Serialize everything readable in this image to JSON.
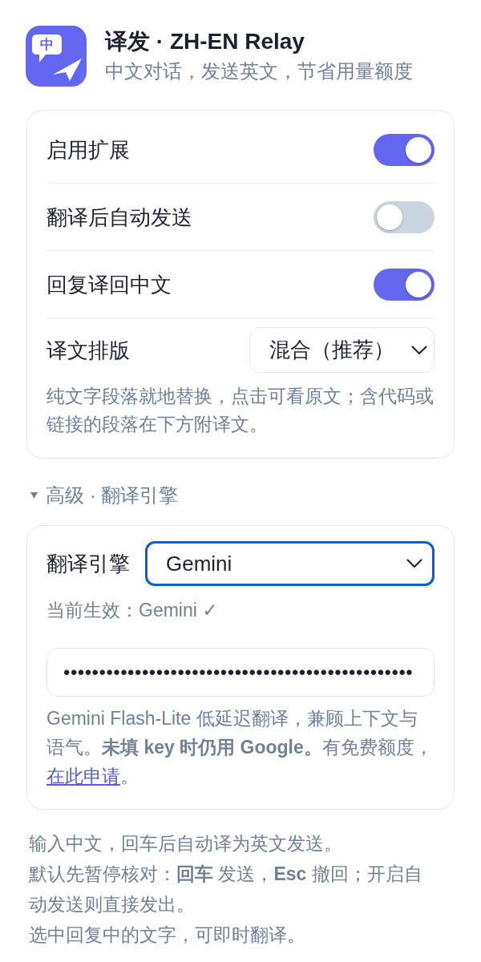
{
  "app": {
    "logo_glyph": "中",
    "title": "译发 · ZH-EN Relay",
    "subtitle": "中文对话，发送英文，节省用量额度"
  },
  "settings": [
    {
      "kind": "toggle",
      "label": "启用扩展",
      "on": true
    },
    {
      "kind": "toggle",
      "label": "翻译后自动发送",
      "on": false
    },
    {
      "kind": "toggle",
      "label": "回复译回中文",
      "on": true
    },
    {
      "kind": "select",
      "label": "译文排版",
      "value": "混合（推荐）"
    }
  ],
  "settings_hint": "纯文字段落就地替换，点击可看原文；含代码或链接的段落在下方附译文。",
  "advanced": {
    "title": "高级 · 翻译引擎",
    "expanded": true,
    "engine": {
      "label": "翻译引擎",
      "value": "Gemini",
      "focused": true
    },
    "status": "当前生效：Gemini ✓",
    "api_key_field": {
      "value": "•••••••••••••••••••••••••••••••••••••••••••••••••"
    },
    "description": {
      "text": "Gemini Flash-Lite 低延迟翻译，兼顾上下文与语气。**未填 key 时仍用 Google。**有免费额度，",
      "link": "在此申请",
      "after": "。"
    }
  },
  "footer": [
    "输入中文，回车后自动译为英文发送。",
    "默认先暂停核对：**回车** 发送，**Esc** 撤回；开启自动发送则直接发出。",
    "选中回复中的文字，可即时翻译。"
  ]
}
